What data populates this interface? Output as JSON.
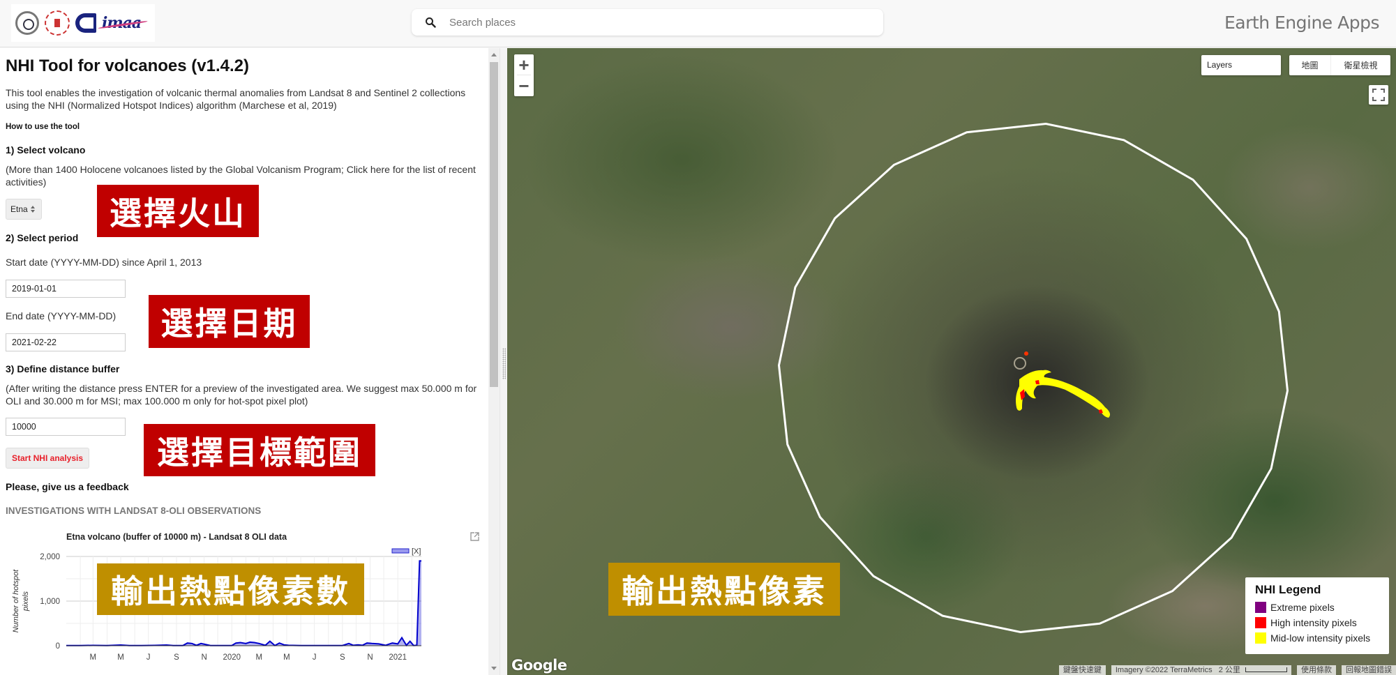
{
  "header": {
    "logos": [
      "university-logo",
      "institute-logo",
      "cnr-logo",
      "imaa-logo"
    ],
    "imaa_text": "imaa",
    "search_placeholder": "Search places",
    "search_icon": "search-icon",
    "app_title": "Earth Engine Apps"
  },
  "panel": {
    "title": "NHI Tool for volcanoes (v1.4.2)",
    "intro": "This tool enables the investigation of volcanic thermal anomalies from Landsat 8 and Sentinel 2 collections using the NHI (Normalized Hotspot Indices) algorithm (Marchese et al, 2019)",
    "how_to": "How to use the tool",
    "step1_title": "1) Select volcano",
    "step1_text": "(More than 1400 Holocene volcanoes listed by the Global Volcanism Program; Click here for the list of recent activities)",
    "volcano_select": "Etna",
    "step2_title": "2) Select period",
    "start_label": "Start date (YYYY-MM-DD) since April 1, 2013",
    "start_value": "2019-01-01",
    "end_label": "End date (YYYY-MM-DD)",
    "end_value": "2021-02-22",
    "step3_title": "3) Define distance buffer",
    "step3_text": "(After writing the distance press ENTER for a preview of the investigated area. We suggest max 50.000 m for OLI and 30.000 m for MSI; max 100.000 m only for hot-spot pixel plot)",
    "buffer_value": "10000",
    "start_button": "Start NHI analysis",
    "feedback": "Please, give us a feedback",
    "section_landsat": "INVESTIGATIONS WITH LANDSAT 8-OLI OBSERVATIONS"
  },
  "annotations": {
    "select_volcano": "選擇火山",
    "select_date": "選擇日期",
    "select_range": "選擇目標範圍",
    "output_count": "輸出熱點像素數",
    "output_pixels": "輸出熱點像素"
  },
  "chart_data": {
    "type": "area",
    "title": "Etna volcano (buffer of 10000 m) - Landsat 8 OLI data",
    "xlabel": "",
    "ylabel": "Number of hotspot pixels",
    "legend": [
      "[X]"
    ],
    "legend_position": "top-right",
    "x_ticks": [
      "M",
      "M",
      "J",
      "S",
      "N",
      "2020",
      "M",
      "M",
      "J",
      "S",
      "N",
      "2021"
    ],
    "y_ticks": [
      "0",
      "1,000",
      "2,000"
    ],
    "ylim": [
      0,
      2000
    ],
    "xlim": [
      "2019-01-01",
      "2021-02-22"
    ],
    "grid": true,
    "series": [
      {
        "name": "[X]",
        "color": "#0000cc",
        "x": [
          "2019-01-01",
          "2019-02-01",
          "2019-03-01",
          "2019-04-01",
          "2019-05-01",
          "2019-05-20",
          "2019-06-15",
          "2019-07-15",
          "2019-08-10",
          "2019-08-25",
          "2019-09-05",
          "2019-09-15",
          "2019-09-25",
          "2019-10-05",
          "2019-10-15",
          "2019-10-25",
          "2019-11-15",
          "2019-12-15",
          "2020-01-01",
          "2020-01-10",
          "2020-01-20",
          "2020-02-01",
          "2020-02-10",
          "2020-02-20",
          "2020-03-01",
          "2020-03-15",
          "2020-03-25",
          "2020-04-05",
          "2020-04-15",
          "2020-04-25",
          "2020-05-05",
          "2020-06-01",
          "2020-07-01",
          "2020-08-01",
          "2020-09-01",
          "2020-09-15",
          "2020-09-25",
          "2020-10-05",
          "2020-10-15",
          "2020-10-25",
          "2020-11-05",
          "2020-11-20",
          "2020-12-05",
          "2020-12-20",
          "2021-01-01",
          "2021-01-10",
          "2021-01-20",
          "2021-01-28",
          "2021-02-05",
          "2021-02-12",
          "2021-02-18",
          "2021-02-22"
        ],
        "y": [
          5,
          5,
          8,
          5,
          15,
          5,
          5,
          8,
          15,
          5,
          5,
          5,
          60,
          50,
          10,
          50,
          5,
          5,
          5,
          60,
          70,
          50,
          80,
          70,
          50,
          10,
          100,
          5,
          60,
          20,
          10,
          5,
          5,
          5,
          5,
          50,
          10,
          20,
          10,
          60,
          50,
          40,
          10,
          60,
          40,
          180,
          10,
          100,
          5,
          10,
          1900,
          1900
        ]
      }
    ]
  },
  "map": {
    "zoom_in": "+",
    "zoom_out": "−",
    "layers_label": "Layers",
    "maptype_map": "地圖",
    "maptype_satellite": "衛星檢視",
    "legend": {
      "title": "NHI Legend",
      "items": [
        {
          "label": "Extreme pixels",
          "color": "#800080"
        },
        {
          "label": "High intensity pixels",
          "color": "#ff0000"
        },
        {
          "label": "Mid-low intensity pixels",
          "color": "#ffff00"
        }
      ]
    },
    "google_label": "Google",
    "attribution": {
      "shortcuts": "鍵盤快速鍵",
      "imagery": "Imagery ©2022 TerraMetrics",
      "scale": "2 公里",
      "terms": "使用條款",
      "report": "回報地圖錯誤"
    }
  }
}
